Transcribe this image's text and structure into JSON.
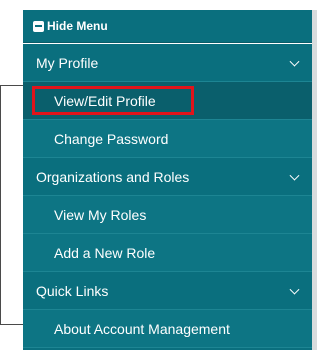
{
  "hide_menu": {
    "label": "Hide Menu",
    "icon": "minus-square-icon"
  },
  "menu": {
    "sections": [
      {
        "label": "My Profile",
        "expanded": true,
        "items": [
          {
            "label": "View/Edit Profile",
            "active": true,
            "highlighted": true
          },
          {
            "label": "Change Password",
            "active": false
          }
        ]
      },
      {
        "label": "Organizations and Roles",
        "expanded": true,
        "items": [
          {
            "label": "View My Roles",
            "active": false
          },
          {
            "label": "Add a New Role",
            "active": false
          }
        ]
      },
      {
        "label": "Quick Links",
        "expanded": true,
        "items": [
          {
            "label": "About Account Management",
            "active": false
          }
        ]
      }
    ]
  },
  "colors": {
    "menu_bg": "#0a6f7e",
    "active_bg": "#0a5f6c",
    "highlight_border": "#e0141b",
    "accent_orange": "#f08a24"
  }
}
